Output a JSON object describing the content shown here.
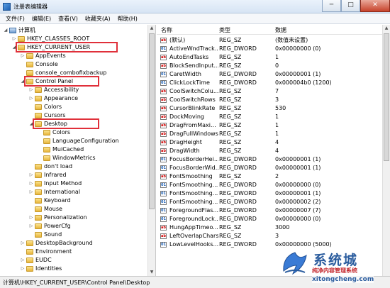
{
  "window": {
    "title": "注册表编辑器",
    "btn_min": "─",
    "btn_max": "□",
    "btn_close": "✕"
  },
  "menu": [
    "文件(F)",
    "编辑(E)",
    "查看(V)",
    "收藏夹(A)",
    "帮助(H)"
  ],
  "tree": [
    {
      "label": "计算机",
      "level": 0,
      "toggle": "◢",
      "kind": "computer"
    },
    {
      "label": "HKEY_CLASSES_ROOT",
      "level": 1,
      "toggle": "▷"
    },
    {
      "label": "HKEY_CURRENT_USER",
      "level": 1,
      "toggle": "◢",
      "highlight": true
    },
    {
      "label": "AppEvents",
      "level": 2,
      "toggle": "▷"
    },
    {
      "label": "Console",
      "level": 2,
      "toggle": ""
    },
    {
      "label": "console_combofixbackup",
      "level": 2,
      "toggle": ""
    },
    {
      "label": "Control Panel",
      "level": 2,
      "toggle": "◢",
      "highlight": true
    },
    {
      "label": "Accessibility",
      "level": 3,
      "toggle": "▷"
    },
    {
      "label": "Appearance",
      "level": 3,
      "toggle": "▷"
    },
    {
      "label": "Colors",
      "level": 3,
      "toggle": ""
    },
    {
      "label": "Cursors",
      "level": 3,
      "toggle": ""
    },
    {
      "label": "Desktop",
      "level": 3,
      "toggle": "◢",
      "highlight": true
    },
    {
      "label": "Colors",
      "level": 4,
      "toggle": ""
    },
    {
      "label": "LanguageConfiguration",
      "level": 4,
      "toggle": ""
    },
    {
      "label": "MuiCached",
      "level": 4,
      "toggle": ""
    },
    {
      "label": "WindowMetrics",
      "level": 4,
      "toggle": ""
    },
    {
      "label": "don't load",
      "level": 3,
      "toggle": ""
    },
    {
      "label": "Infrared",
      "level": 3,
      "toggle": "▷"
    },
    {
      "label": "Input Method",
      "level": 3,
      "toggle": "▷"
    },
    {
      "label": "International",
      "level": 3,
      "toggle": "▷"
    },
    {
      "label": "Keyboard",
      "level": 3,
      "toggle": ""
    },
    {
      "label": "Mouse",
      "level": 3,
      "toggle": ""
    },
    {
      "label": "Personalization",
      "level": 3,
      "toggle": "▷"
    },
    {
      "label": "PowerCfg",
      "level": 3,
      "toggle": "▷"
    },
    {
      "label": "Sound",
      "level": 3,
      "toggle": ""
    },
    {
      "label": "DesktopBackground",
      "level": 2,
      "toggle": "▷"
    },
    {
      "label": "Environment",
      "level": 2,
      "toggle": ""
    },
    {
      "label": "EUDC",
      "level": 2,
      "toggle": "▷"
    },
    {
      "label": "Identities",
      "level": 2,
      "toggle": "▷"
    }
  ],
  "columns": {
    "name": "名称",
    "type": "类型",
    "data": "数据"
  },
  "values": [
    {
      "name": "(默认)",
      "type": "REG_SZ",
      "data": "(数值未设置)",
      "kind": "sz"
    },
    {
      "name": "ActiveWndTrack...",
      "type": "REG_DWORD",
      "data": "0x00000000 (0)",
      "kind": "bin"
    },
    {
      "name": "AutoEndTasks",
      "type": "REG_SZ",
      "data": "1",
      "kind": "sz"
    },
    {
      "name": "BlockSendInput...",
      "type": "REG_SZ",
      "data": "0",
      "kind": "sz"
    },
    {
      "name": "CaretWidth",
      "type": "REG_DWORD",
      "data": "0x00000001 (1)",
      "kind": "bin"
    },
    {
      "name": "ClickLockTime",
      "type": "REG_DWORD",
      "data": "0x000004b0 (1200)",
      "kind": "bin"
    },
    {
      "name": "CoolSwitchColu...",
      "type": "REG_SZ",
      "data": "7",
      "kind": "sz"
    },
    {
      "name": "CoolSwitchRows",
      "type": "REG_SZ",
      "data": "3",
      "kind": "sz"
    },
    {
      "name": "CursorBlinkRate",
      "type": "REG_SZ",
      "data": "530",
      "kind": "sz"
    },
    {
      "name": "DockMoving",
      "type": "REG_SZ",
      "data": "1",
      "kind": "sz"
    },
    {
      "name": "DragFromMaxi...",
      "type": "REG_SZ",
      "data": "1",
      "kind": "sz"
    },
    {
      "name": "DragFullWindows",
      "type": "REG_SZ",
      "data": "1",
      "kind": "sz"
    },
    {
      "name": "DragHeight",
      "type": "REG_SZ",
      "data": "4",
      "kind": "sz"
    },
    {
      "name": "DragWidth",
      "type": "REG_SZ",
      "data": "4",
      "kind": "sz"
    },
    {
      "name": "FocusBorderHei...",
      "type": "REG_DWORD",
      "data": "0x00000001 (1)",
      "kind": "bin"
    },
    {
      "name": "FocusBorderWid...",
      "type": "REG_DWORD",
      "data": "0x00000001 (1)",
      "kind": "bin"
    },
    {
      "name": "FontSmoothing",
      "type": "REG_SZ",
      "data": "2",
      "kind": "sz"
    },
    {
      "name": "FontSmoothing...",
      "type": "REG_DWORD",
      "data": "0x00000000 (0)",
      "kind": "bin"
    },
    {
      "name": "FontSmoothing...",
      "type": "REG_DWORD",
      "data": "0x00000001 (1)",
      "kind": "bin"
    },
    {
      "name": "FontSmoothing...",
      "type": "REG_DWORD",
      "data": "0x00000002 (2)",
      "kind": "bin"
    },
    {
      "name": "ForegroundFlas...",
      "type": "REG_DWORD",
      "data": "0x00000007 (7)",
      "kind": "bin"
    },
    {
      "name": "ForegroundLock...",
      "type": "REG_DWORD",
      "data": "0x00000000 (0)",
      "kind": "bin"
    },
    {
      "name": "HungAppTimeo...",
      "type": "REG_SZ",
      "data": "3000",
      "kind": "sz"
    },
    {
      "name": "LeftOverlapChars",
      "type": "REG_SZ",
      "data": "3",
      "kind": "sz"
    },
    {
      "name": "LowLevelHooks...",
      "type": "REG_DWORD",
      "data": "0x00000000 (5000)",
      "kind": "bin"
    }
  ],
  "statusbar": "计算机\\HKEY_CURRENT_USER\\Control Panel\\Desktop",
  "watermark": {
    "big": "系统城",
    "small": "纯净内容管理系统",
    "url": "xitongcheng.com"
  },
  "colors": {
    "highlight": "#e0303a",
    "folder": "#e7b53c"
  }
}
